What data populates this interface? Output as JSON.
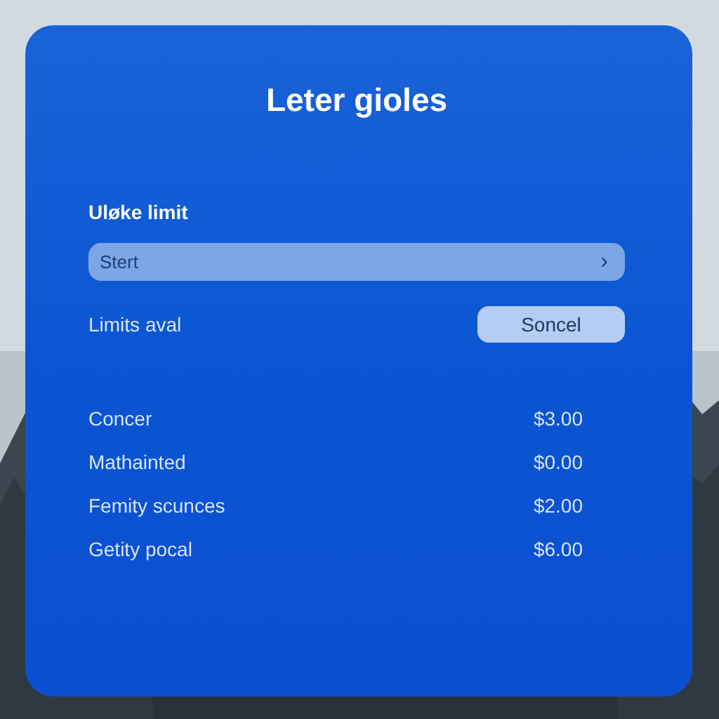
{
  "title": "Leter gioles",
  "section_label": "Uløke limit",
  "select": {
    "value": "Stert",
    "chevron": "›"
  },
  "limits_row": {
    "label": "Limits aval",
    "button": "Soncel"
  },
  "items": [
    {
      "name": "Concer",
      "amount": "$3.00"
    },
    {
      "name": "Mathainted",
      "amount": "$0.00"
    },
    {
      "name": "Femity scunces",
      "amount": "$2.00"
    },
    {
      "name": "Getity pocal",
      "amount": "$6.00"
    }
  ]
}
